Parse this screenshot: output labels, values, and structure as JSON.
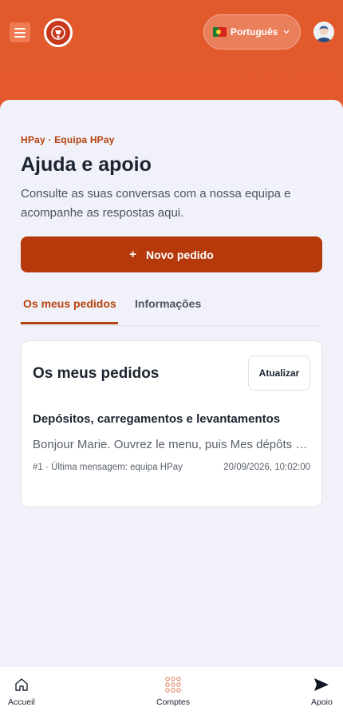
{
  "header": {
    "language": "Português",
    "colors": {
      "primary": "#e15a2c",
      "accent": "#b5390b"
    }
  },
  "icons": {
    "menu": "hamburger-icon",
    "logo": "brand-logo",
    "flag": "portugal-flag-icon",
    "chevron": "chevron-down-icon",
    "avatar": "user-avatar-icon"
  },
  "page": {
    "eyebrow": "HPay · Equipa HPay",
    "title": "Ajuda e apoio",
    "subtitle": "Consulte as suas conversas com a nossa equipa e acompanhe as respostas aqui.",
    "new_request_label": "Novo pedido",
    "plus_glyph": "+"
  },
  "tabs": [
    {
      "label": "Os meus pedidos",
      "active": true
    },
    {
      "label": "Informações",
      "active": false
    }
  ],
  "requests_card": {
    "title": "Os meus pedidos",
    "refresh_label": "Atualizar",
    "items": [
      {
        "title": "Depósitos, carregamentos e levantamentos",
        "preview": "Bonjour Marie. Ouvrez le menu, puis Mes dépôts pour suivre vos opérations",
        "meta": "#1 · Última mensagem: equipa HPay",
        "date": "20/09/2026, 10:02:00"
      }
    ]
  },
  "bottom_nav": [
    {
      "label": "Accueil",
      "icon": "home-icon"
    },
    {
      "label": "Comptes",
      "icon": "grid-icon"
    },
    {
      "label": "Apoio",
      "icon": "send-icon"
    }
  ]
}
